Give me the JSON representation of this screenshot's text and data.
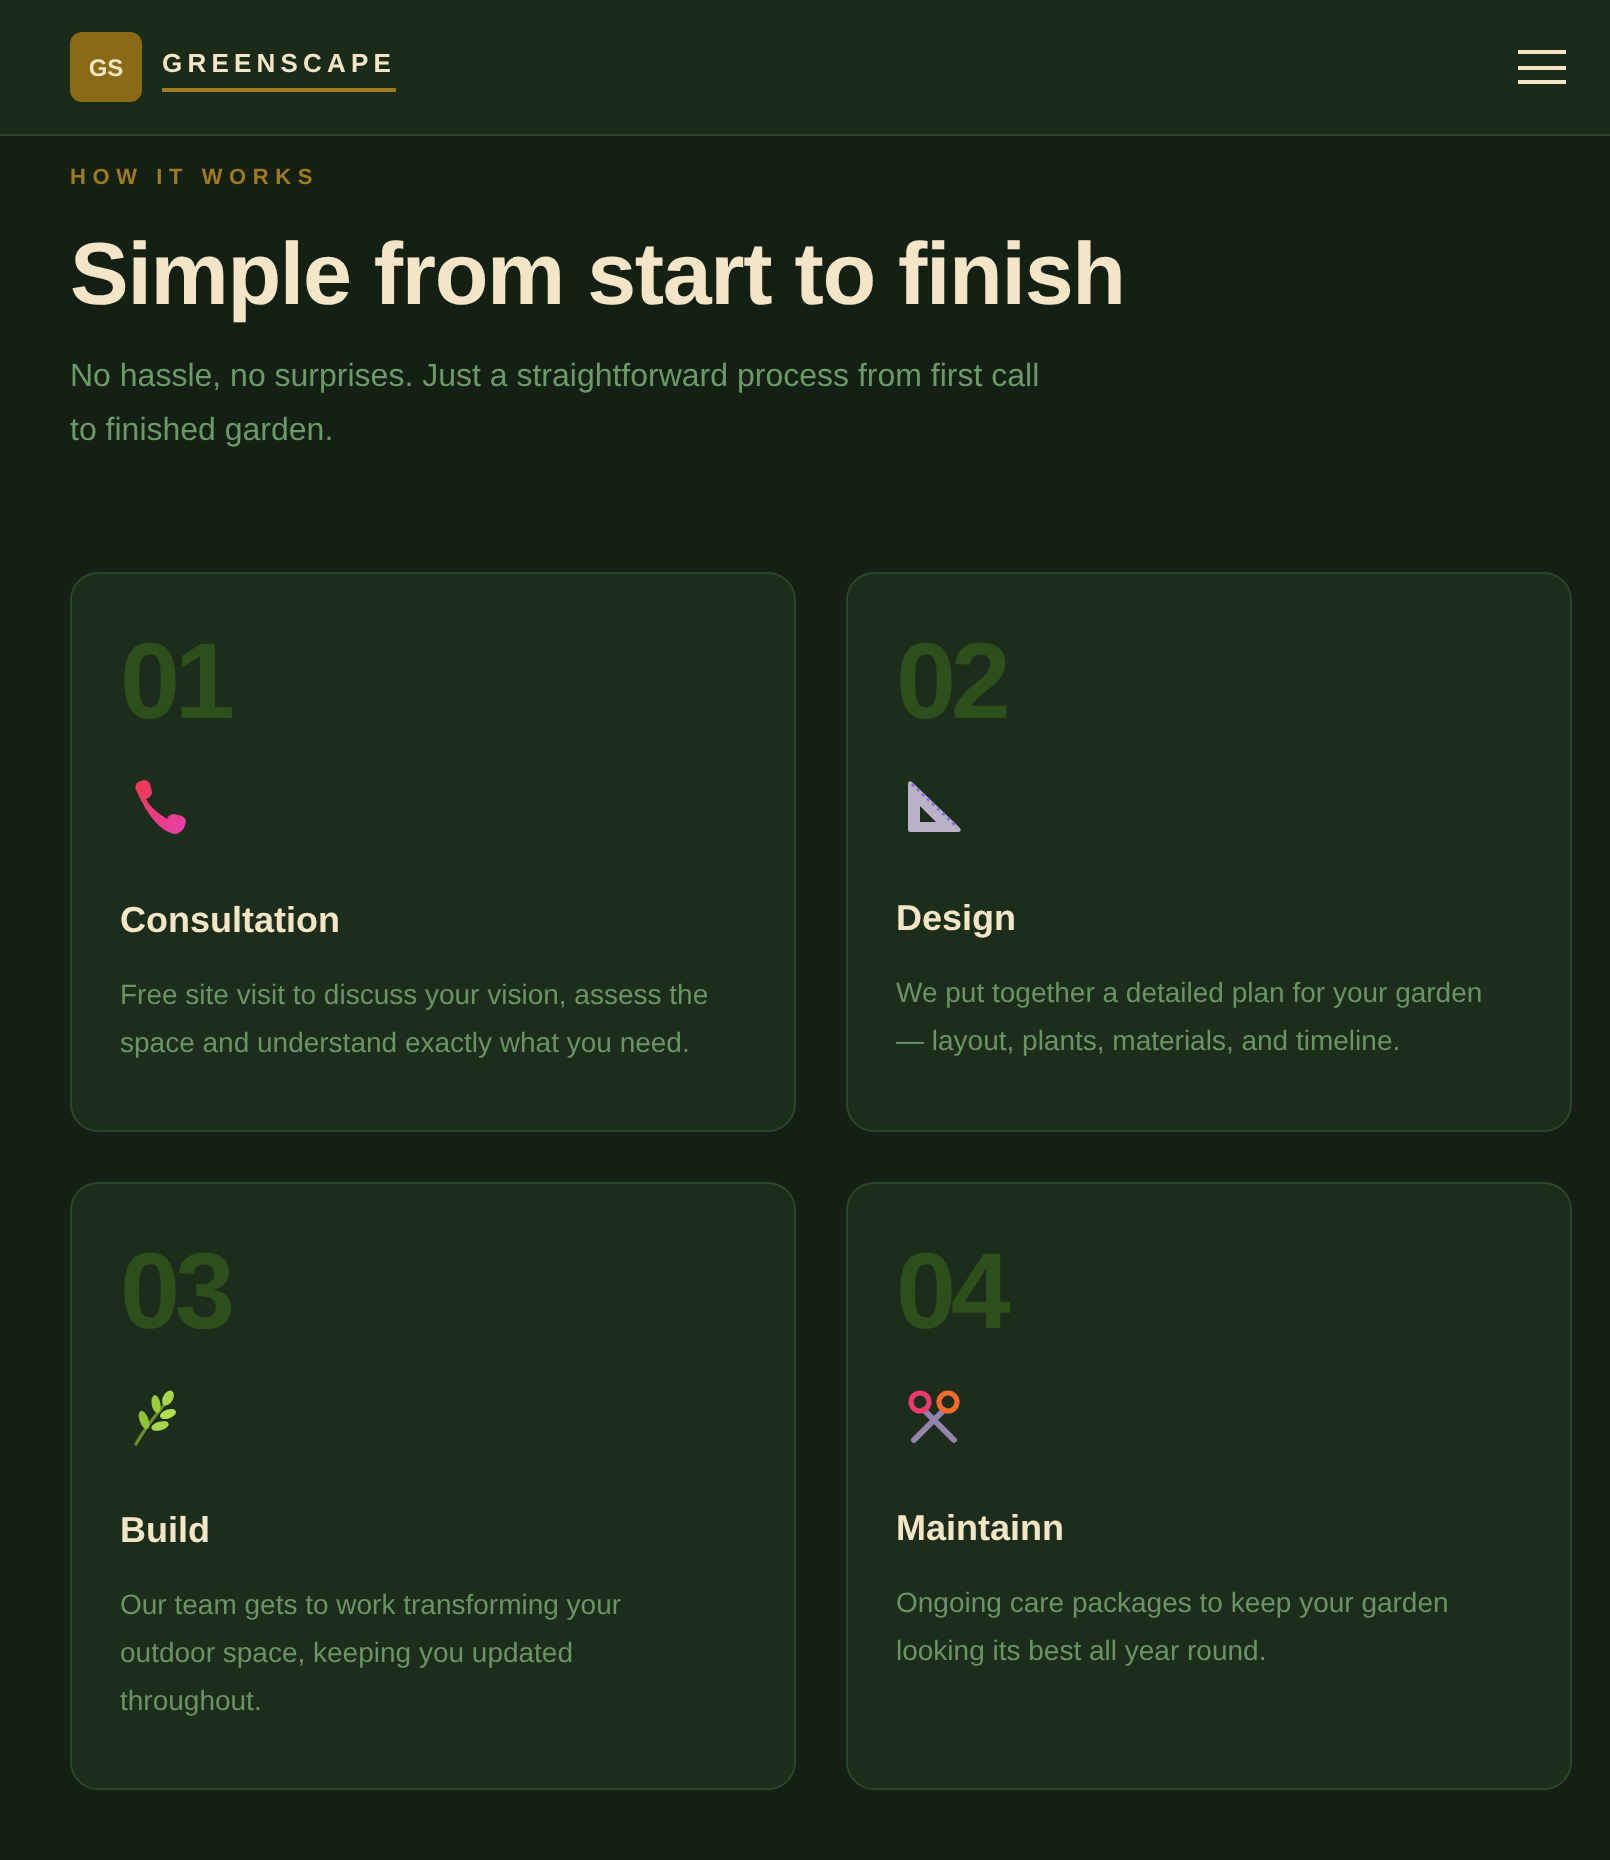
{
  "header": {
    "logo_initials": "GS",
    "brand": "GREENSCAPE"
  },
  "section": {
    "eyebrow": "HOW IT WORKS",
    "title": "Simple from start to finish",
    "subtitle": "No hassle, no surprises. Just a straightforward process from first call to finished garden."
  },
  "steps": [
    {
      "number": "01",
      "title": "Consultation",
      "description": "Free site visit to discuss your vision, assess the space and understand exactly what you need."
    },
    {
      "number": "02",
      "title": "Design",
      "description": "We put together a detailed plan for your garden — layout, plants, materials, and timeline."
    },
    {
      "number": "03",
      "title": "Build",
      "description": "Our team gets to work transforming your outdoor space, keeping you updated throughout."
    },
    {
      "number": "04",
      "title": "Maintainn",
      "description": "Ongoing care packages to keep your garden looking its best all year round."
    }
  ]
}
